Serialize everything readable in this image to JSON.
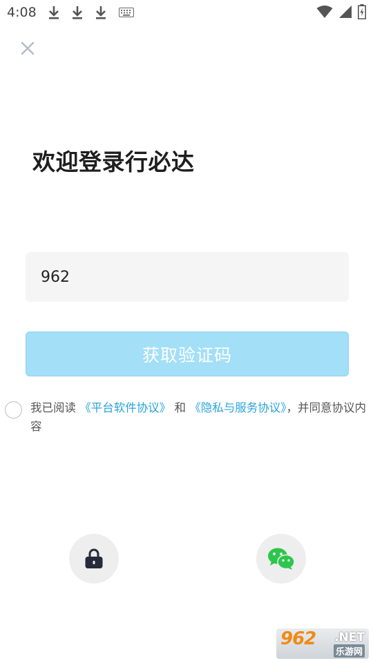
{
  "status_bar": {
    "time": "4:08",
    "left_icons": [
      "download-icon",
      "download-icon",
      "download-icon",
      "keyboard-icon"
    ],
    "right_icons": [
      "wifi-icon",
      "cell-signal-icon",
      "battery-charging-icon"
    ]
  },
  "header": {
    "close_icon": "close-icon"
  },
  "title": "欢迎登录行必达",
  "phone_input": {
    "value": "962",
    "placeholder": ""
  },
  "get_code_button": {
    "label": "获取验证码",
    "color": "#a3dff7"
  },
  "agreement": {
    "prefix": "我已阅读 ",
    "platform_link": "《平台软件协议》",
    "and": " 和 ",
    "privacy_link": "《隐私与服务协议》",
    "suffix": "，并同意协议内容",
    "link_color": "#2aa4d8"
  },
  "alt_login": {
    "password_icon": "lock-icon",
    "wechat_icon": "wechat-icon",
    "wechat_color": "#2dc64c"
  },
  "watermark": {
    "brand": "962",
    "domain": ".NET",
    "site": "乐游网"
  }
}
